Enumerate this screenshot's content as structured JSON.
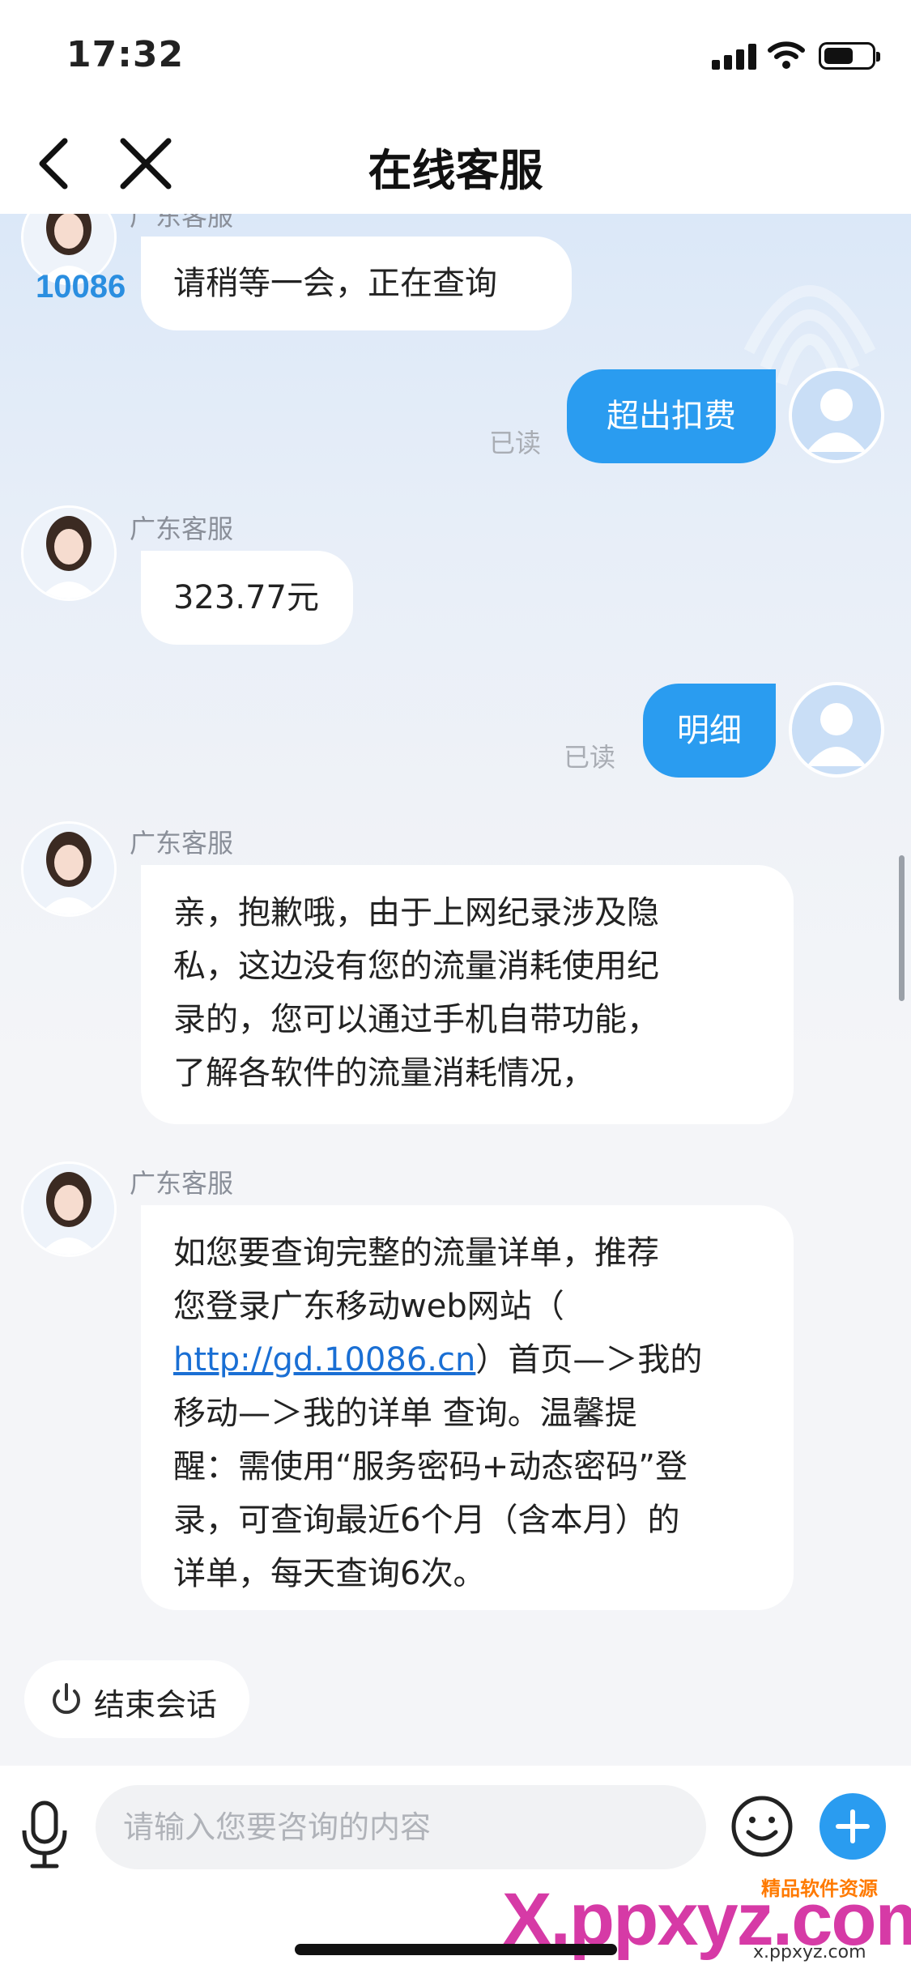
{
  "status_bar": {
    "time": "17:32"
  },
  "nav": {
    "title": "在线客服"
  },
  "messages": {
    "m1": {
      "sender": "广东客服",
      "text": "请稍等一会，正在查询"
    },
    "m2": {
      "text": "超出扣费",
      "read": "已读"
    },
    "m3": {
      "sender": "广东客服",
      "text": "323.77元"
    },
    "m4": {
      "text": "明细",
      "read": "已读"
    },
    "m5": {
      "sender": "广东客服",
      "lines": [
        "亲，抱歉哦，由于上网纪录涉及隐",
        "私，这边没有您的流量消耗使用纪",
        "录的，您可以通过手机自带功能，",
        "了解各软件的流量消耗情况，"
      ]
    },
    "m6": {
      "sender": "广东客服",
      "line1": "如您要查询完整的流量详单，推荐",
      "line2_pre": "您登录广东移动web网站（",
      "link": "http://gd.10086.cn",
      "line3_post": "）首页—＞我的",
      "line4": "移动—＞我的详单 查询。温馨提",
      "line5": "醒：需使用“服务密码+动态密码”登",
      "line6": "录，可查询最近6个月（含本月）的",
      "line7": "详单，每天查询6次。"
    }
  },
  "end_session_label": "结束会话",
  "input": {
    "placeholder": "请输入您要咨询的内容"
  },
  "logo_text": "10086",
  "watermark": {
    "main": "X.ppxyz.com",
    "small": "精品软件资源",
    "url": "x.ppxyz.com"
  },
  "colors": {
    "accent": "#2a9cf0",
    "bubble_out_text": "#ffffff"
  }
}
